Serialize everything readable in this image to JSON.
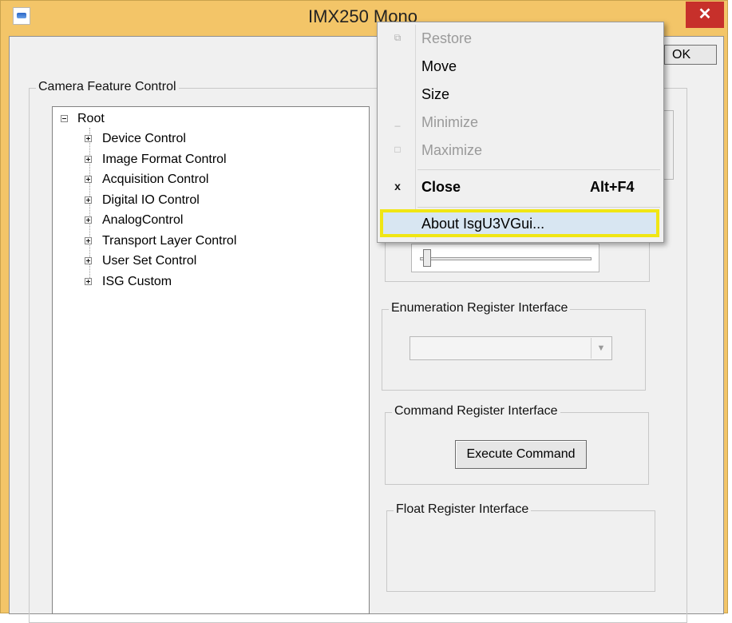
{
  "window": {
    "title": "IMX250 Mono",
    "close_glyph": "✕"
  },
  "dialog": {
    "ok_label": "OK"
  },
  "feature_group": {
    "label": "Camera Feature Control"
  },
  "tree": {
    "root": "Root",
    "items": [
      {
        "label": "Device Control"
      },
      {
        "label": "Image Format Control"
      },
      {
        "label": "Acquisition Control"
      },
      {
        "label": "Digital IO Control"
      },
      {
        "label": "AnalogControl"
      },
      {
        "label": "Transport Layer Control"
      },
      {
        "label": "User Set Control"
      },
      {
        "label": "ISG Custom"
      }
    ]
  },
  "enumeration": {
    "label": "Enumeration Register Interface",
    "selected": ""
  },
  "command": {
    "label": "Command Register Interface",
    "button_label": "Execute Command"
  },
  "float_reg": {
    "label": "Float Register Interface"
  },
  "system_menu": {
    "items": [
      {
        "label": "Restore",
        "icon": "restore-icon",
        "enabled": false
      },
      {
        "label": "Move",
        "enabled": true
      },
      {
        "label": "Size",
        "enabled": true
      },
      {
        "label": "Minimize",
        "icon": "minimize-icon",
        "enabled": false
      },
      {
        "label": "Maximize",
        "icon": "maximize-icon",
        "enabled": false
      },
      {
        "label": "Close",
        "icon": "close-icon",
        "glyph": "x",
        "shortcut": "Alt+F4",
        "enabled": true
      },
      {
        "label": "About IsgU3VGui...",
        "enabled": true,
        "highlighted": true
      }
    ]
  },
  "colors": {
    "titlebar": "#f3c568",
    "close_button": "#c7302b",
    "highlight_border": "#f0e614"
  }
}
